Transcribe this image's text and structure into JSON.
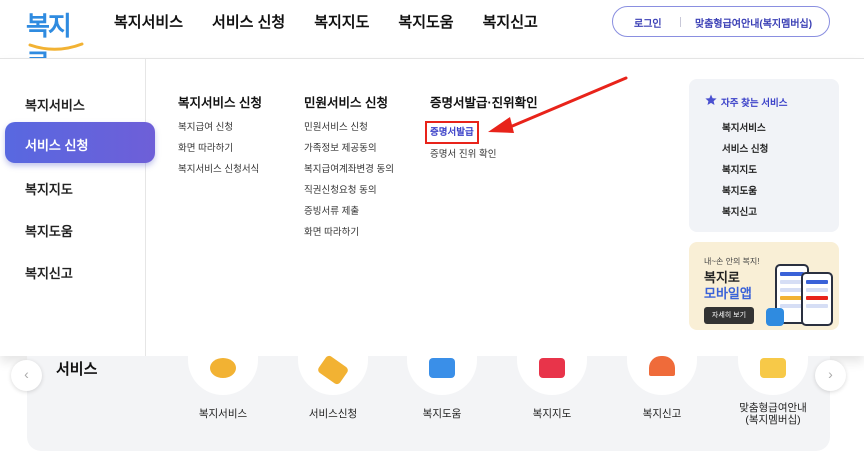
{
  "logo": {
    "text": "복지로",
    "brand_color": "#2f8be0"
  },
  "gnb": [
    "복지서비스",
    "서비스 신청",
    "복지지도",
    "복지도움",
    "복지신고"
  ],
  "util": {
    "login": "로그인",
    "guide": "맞춤형급여안내(복지멤버십)"
  },
  "left_menu": {
    "items": [
      "복지서비스",
      "서비스 신청",
      "복지지도",
      "복지도움",
      "복지신고"
    ],
    "active": "서비스 신청",
    "active_color": "#5868e0"
  },
  "columns": [
    {
      "title": "복지서비스 신청",
      "links": [
        "복지급여 신청",
        "화면 따라하기",
        "복지서비스 신청서식"
      ]
    },
    {
      "title": "민원서비스 신청",
      "links": [
        "민원서비스 신청",
        "가족정보 제공동의",
        "복지급여계좌변경 동의",
        "직권신청요청 동의",
        "증빙서류 제출",
        "화면 따라하기"
      ]
    },
    {
      "title": "증명서발급·진위확인",
      "links": [
        "증명서발급",
        "증명서 진위 확인"
      ],
      "highlighted": "증명서발급"
    }
  ],
  "favorites": {
    "title": "자주 찾는 서비스",
    "icon": "star-icon",
    "items": [
      "복지서비스",
      "서비스 신청",
      "복지지도",
      "복지도움",
      "복지신고"
    ]
  },
  "promo": {
    "small": "내~손 안의 복지!",
    "line1": "복지로",
    "line2": "모바일앱",
    "button": "자세히 보기"
  },
  "annotation": {
    "color": "#e8231a"
  },
  "services": {
    "title": "서비스",
    "items": [
      "복지서비스",
      "서비스신청",
      "복지도움",
      "복지지도",
      "복지신고",
      "맞춤형급여안내\n(복지멤버십)"
    ],
    "prev": "‹",
    "next": "›"
  }
}
